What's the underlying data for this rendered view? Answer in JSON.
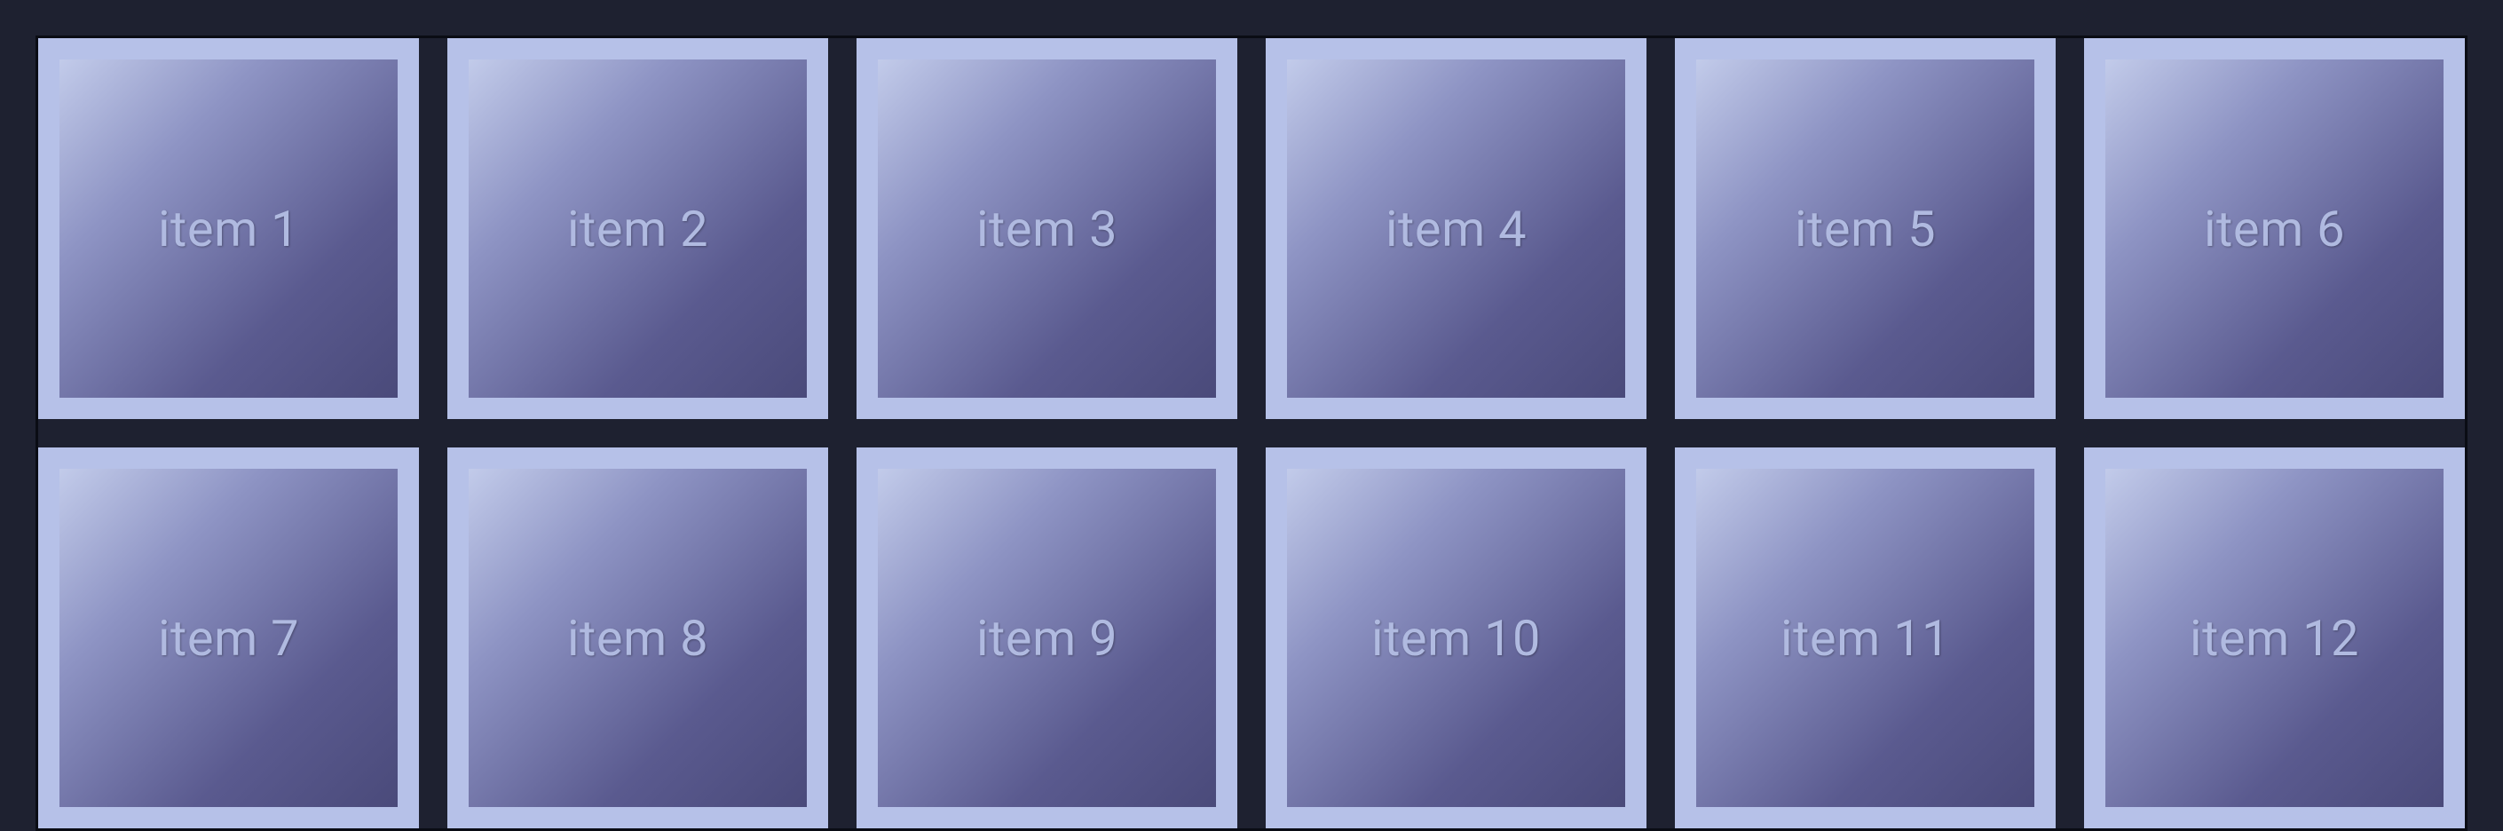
{
  "grid": {
    "items": [
      {
        "label": "item 1"
      },
      {
        "label": "item 2"
      },
      {
        "label": "item 3"
      },
      {
        "label": "item 4"
      },
      {
        "label": "item 5"
      },
      {
        "label": "item 6"
      },
      {
        "label": "item 7"
      },
      {
        "label": "item 8"
      },
      {
        "label": "item 9"
      },
      {
        "label": "item 10"
      },
      {
        "label": "item 11"
      },
      {
        "label": "item 12"
      }
    ]
  },
  "colors": {
    "background": "#1e2130",
    "itemFrame": "#b6c1e8",
    "gradientStart": "#c2cbea",
    "gradientEnd": "#4a4a7a",
    "labelColor": "#b0bae0",
    "border": "#0a0c14"
  }
}
